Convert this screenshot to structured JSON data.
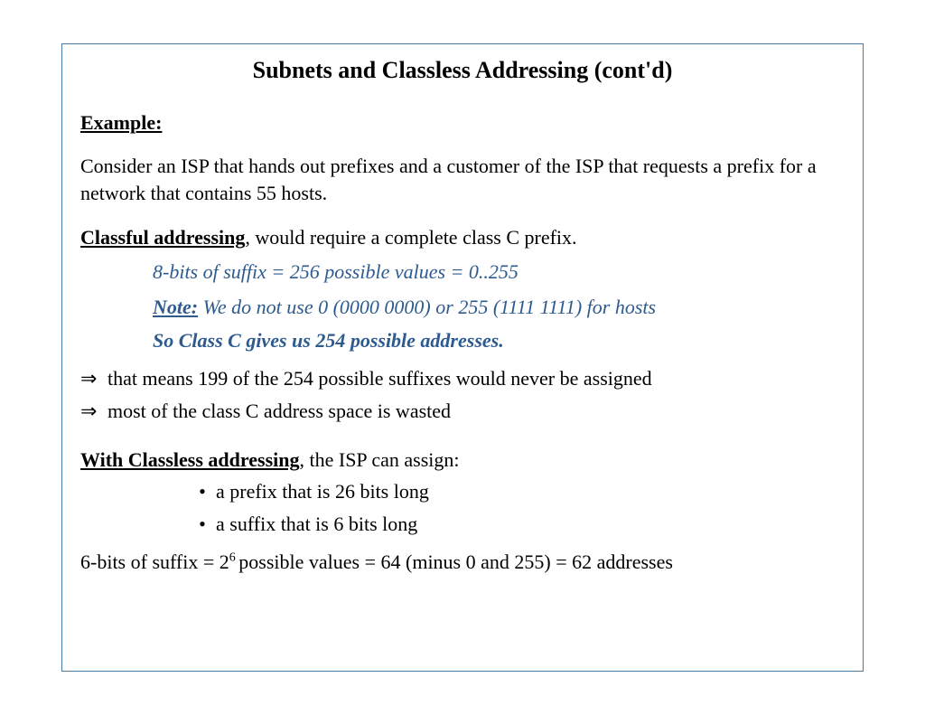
{
  "title": "Subnets and Classless Addressing (cont'd)",
  "example_label": "Example:",
  "example_text": "Consider an ISP that hands out prefixes and a customer of the ISP that requests a prefix for a network that contains 55 hosts.",
  "classful_label": "Classful addressing",
  "classful_text": ", would require a complete class C prefix.",
  "suffix_line": "8-bits of suffix = 256 possible values = 0..255",
  "note_label": "Note:",
  "note_text": " We do not use 0 (0000 0000) or 255 (1111 1111) for hosts",
  "classc_result": "So Class C gives us 254 possible addresses.",
  "arrow1": "that means 199 of the 254 possible suffixes would never be assigned",
  "arrow2": "most of the class C address space is wasted",
  "classless_label": "With Classless addressing",
  "classless_text": ", the ISP can assign:",
  "bullet1": "a prefix that is 26 bits long",
  "bullet2": "a suffix that is 6 bits long",
  "final_prefix": "6-bits of suffix = 2",
  "final_exp": "6 ",
  "final_suffix": "possible values = 64 (minus 0 and 255) = 62 addresses",
  "arrow_glyph": "⇒",
  "bullet_glyph": "•"
}
